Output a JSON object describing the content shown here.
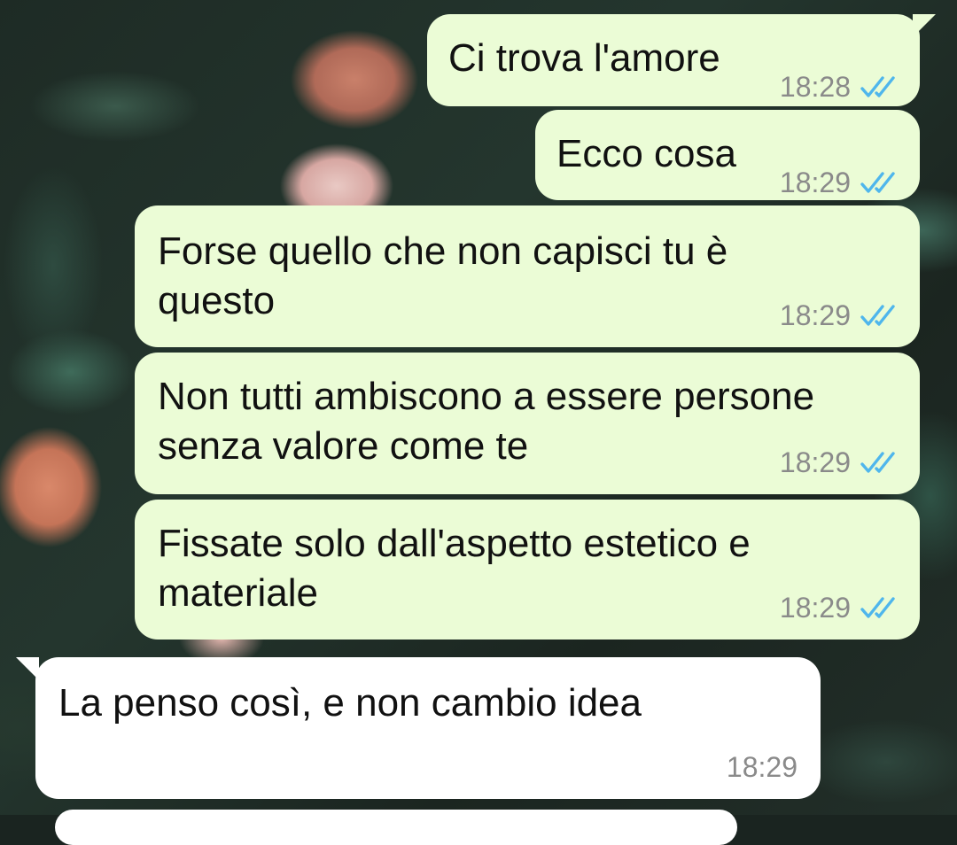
{
  "chat": {
    "messages": [
      {
        "direction": "outgoing",
        "text": "Ci trova l'amore",
        "time": "18:28",
        "status": "read",
        "status_icon": "double-check-icon"
      },
      {
        "direction": "outgoing",
        "text": "Ecco cosa",
        "time": "18:29",
        "status": "read",
        "status_icon": "double-check-icon"
      },
      {
        "direction": "outgoing",
        "text": "Forse quello che non capisci tu è\nquesto",
        "time": "18:29",
        "status": "read",
        "status_icon": "double-check-icon"
      },
      {
        "direction": "outgoing",
        "text": "Non tutti ambiscono a essere persone\nsenza valore come te",
        "time": "18:29",
        "status": "read",
        "status_icon": "double-check-icon"
      },
      {
        "direction": "outgoing",
        "text": "Fissate solo dall'aspetto estetico e\nmateriale",
        "time": "18:29",
        "status": "read",
        "status_icon": "double-check-icon"
      },
      {
        "direction": "incoming",
        "text": "La penso così, e non cambio idea",
        "time": "18:29"
      }
    ]
  },
  "colors": {
    "outgoing_bubble": "#ebfcd6",
    "incoming_bubble": "#ffffff",
    "read_ticks": "#4fb6ec",
    "timestamp": "#8a8a8a",
    "message_text": "#111111"
  }
}
